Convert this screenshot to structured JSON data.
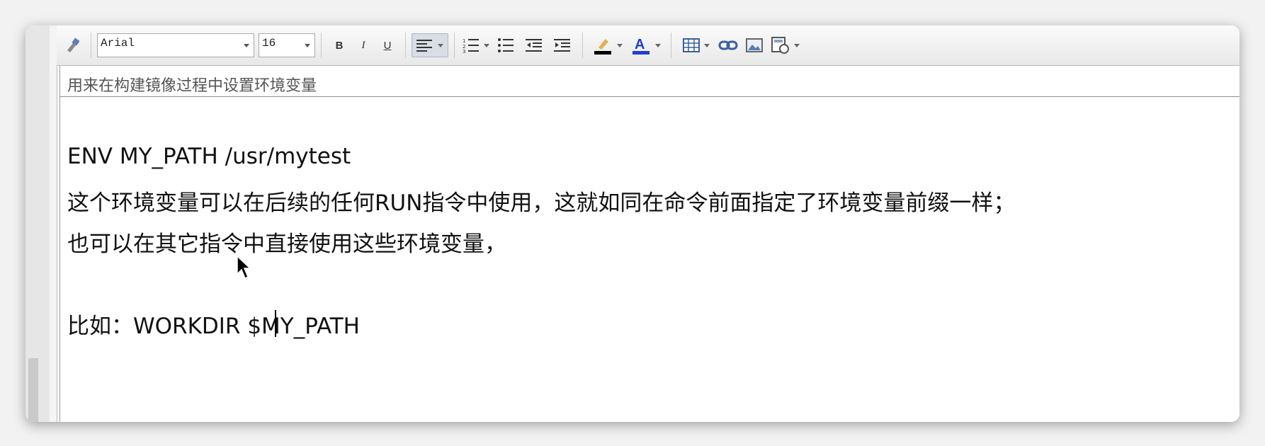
{
  "toolbar": {
    "font_name": "Arial",
    "font_size": "16",
    "bold_label": "B",
    "italic_label": "I",
    "underline_label": "U",
    "icons": [
      "format-painter-icon",
      "align-left-icon",
      "ordered-list-icon",
      "unordered-list-icon",
      "outdent-icon",
      "indent-icon",
      "highlight-color-icon",
      "font-color-icon",
      "table-icon",
      "link-icon",
      "image-icon",
      "insert-special-icon"
    ],
    "highlight_color": "#000000",
    "font_color": "#1f3fd0"
  },
  "editor": {
    "title_value": "用来在构建镜像过程中设置环境变量",
    "lines": [
      "ENV MY_PATH /usr/mytest",
      "这个环境变量可以在后续的任何RUN指令中使用，这就如同在命令前面指定了环境变量前缀一样；",
      "也可以在其它指令中直接使用这些环境变量，",
      "比如：WORKDIR $MY_PATH"
    ]
  }
}
